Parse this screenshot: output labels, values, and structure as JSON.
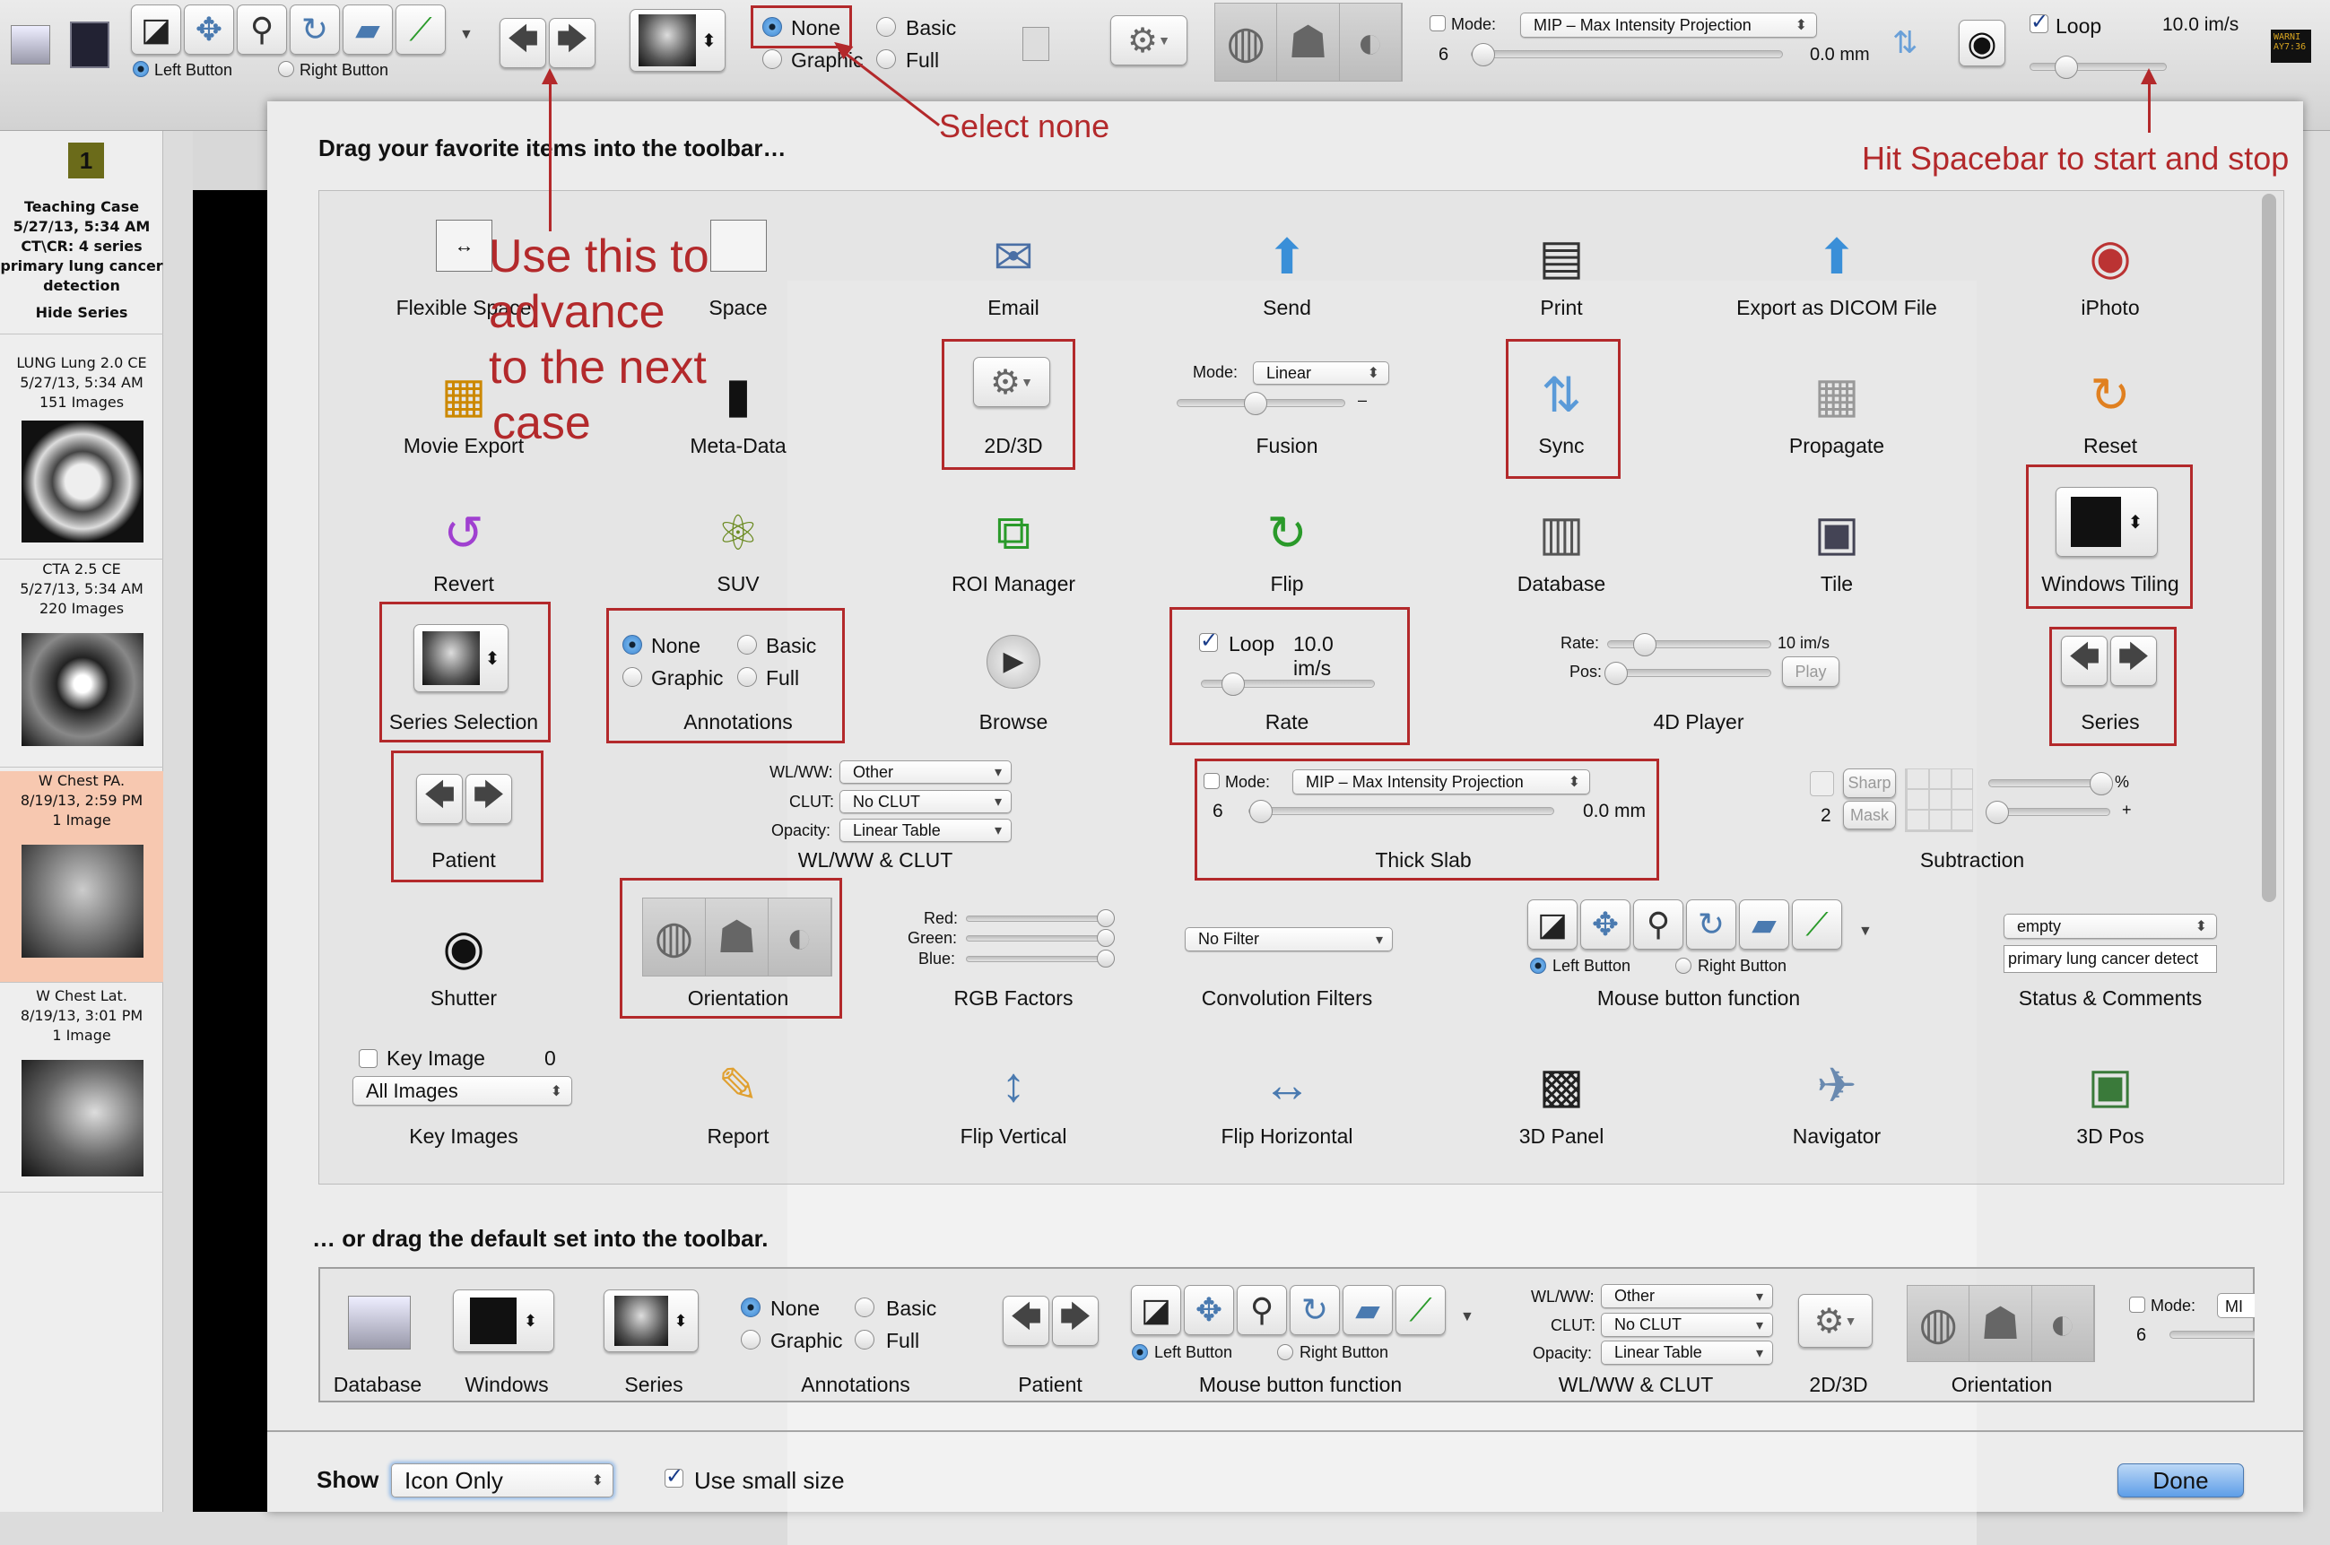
{
  "toolbar": {
    "left_button": "Left Button",
    "right_button": "Right Button",
    "ann": {
      "none": "None",
      "basic": "Basic",
      "graphic": "Graphic",
      "full": "Full",
      "selected": "None"
    },
    "mode_label": "Mode:",
    "mode_value": "MIP – Max Intensity Projection",
    "slab_count": "6",
    "slab_thickness": "0.0 mm",
    "loop_label": "Loop",
    "loop_checked": true,
    "rate": "10.0 im/s",
    "rate_fraction": 0.2,
    "warning_text": "WARNI AY7:36"
  },
  "tools": [
    {
      "icon": "window-level-icon",
      "glyph": "◪"
    },
    {
      "icon": "move-icon",
      "glyph": "✥"
    },
    {
      "icon": "zoom-icon",
      "glyph": "⚲"
    },
    {
      "icon": "rotate-icon",
      "glyph": "↻"
    },
    {
      "icon": "scroll-icon",
      "glyph": "▰"
    },
    {
      "icon": "length-icon",
      "glyph": "⟋"
    }
  ],
  "overlay": {
    "select_none": "Select none",
    "spacebar": "Hit Spacebar to start and stop",
    "advance_lines": [
      "Use this to",
      "advance",
      "to the next",
      "case"
    ],
    "color": "#b3292b"
  },
  "sidebar": {
    "badge": "1",
    "study": {
      "title": "Teaching Case",
      "date": "5/27/13, 5:34 AM",
      "modality": "CT\\CR: 4 series",
      "desc1": "primary lung cancer",
      "desc2": "detection",
      "hide": "Hide Series"
    },
    "series": [
      {
        "name": "LUNG Lung 2.0 CE",
        "date": "5/27/13, 5:34 AM",
        "count": "151 Images"
      },
      {
        "name": "CTA 2.5 CE",
        "date": "5/27/13, 5:34 AM",
        "count": "220 Images"
      },
      {
        "name": "W Chest PA.",
        "date": "8/19/13, 2:59 PM",
        "count": "1 Image",
        "selected": true
      },
      {
        "name": "W Chest Lat.",
        "date": "8/19/13, 3:01 PM",
        "count": "1 Image"
      }
    ],
    "selected_color": "#f7c8b0"
  },
  "sheet": {
    "title": "Drag your favorite items into the toolbar…",
    "default_title": "… or drag the default set into the toolbar."
  },
  "palette": {
    "items": [
      {
        "label": "Flexible Space",
        "icon": "flexible-space"
      },
      {
        "label": "Space",
        "icon": "space"
      },
      {
        "label": "Email",
        "icon": "email"
      },
      {
        "label": "Send",
        "icon": "send"
      },
      {
        "label": "Print",
        "icon": "print"
      },
      {
        "label": "Export as DICOM File",
        "icon": "export-dicom"
      },
      {
        "label": "iPhoto",
        "icon": "iphoto"
      },
      {
        "label": "Movie Export",
        "icon": "movie-export"
      },
      {
        "label": "Meta-Data",
        "icon": "meta-data"
      },
      {
        "label": "2D/3D",
        "icon": "custom"
      },
      {
        "label": "Fusion",
        "icon": "custom"
      },
      {
        "label": "Sync",
        "icon": "sync"
      },
      {
        "label": "Propagate",
        "icon": "propagate"
      },
      {
        "label": "Reset",
        "icon": "reset"
      },
      {
        "label": "Revert",
        "icon": "revert"
      },
      {
        "label": "SUV",
        "icon": "suv"
      },
      {
        "label": "ROI Manager",
        "icon": "roi-manager"
      },
      {
        "label": "Flip",
        "icon": "flip"
      },
      {
        "label": "Database",
        "icon": "database"
      },
      {
        "label": "Tile",
        "icon": "tile"
      },
      {
        "label": "Windows Tiling",
        "icon": "custom"
      },
      {
        "label": "Series Selection",
        "icon": "custom"
      },
      {
        "label": "Annotations",
        "icon": "custom"
      },
      {
        "label": "Browse",
        "icon": "browse"
      },
      {
        "label": "Rate",
        "icon": "custom"
      },
      {
        "label": "4D Player",
        "icon": "custom"
      },
      {
        "label": "Series",
        "icon": "custom"
      },
      {
        "label": "Patient",
        "icon": "custom"
      },
      {
        "label": "WL/WW & CLUT",
        "icon": "custom"
      },
      {
        "label": "Thick Slab",
        "icon": "custom"
      },
      {
        "label": "Subtraction",
        "icon": "custom"
      },
      {
        "label": "Shutter",
        "icon": "shutter"
      },
      {
        "label": "Orientation",
        "icon": "custom"
      },
      {
        "label": "RGB Factors",
        "icon": "custom"
      },
      {
        "label": "Convolution Filters",
        "icon": "custom"
      },
      {
        "label": "Mouse button function",
        "icon": "custom"
      },
      {
        "label": "Status & Comments",
        "icon": "custom"
      },
      {
        "label": "Key Images",
        "icon": "custom"
      },
      {
        "label": "Report",
        "icon": "report"
      },
      {
        "label": "Flip Vertical",
        "icon": "flip-vertical"
      },
      {
        "label": "Flip Horizontal",
        "icon": "flip-horizontal"
      },
      {
        "label": "3D Panel",
        "icon": "3d-panel"
      },
      {
        "label": "Navigator",
        "icon": "navigator"
      },
      {
        "label": "3D Pos",
        "icon": "3d-pos"
      }
    ],
    "fusion": {
      "mode_label": "Mode:",
      "mode_value": "Linear",
      "minus": "–"
    },
    "rate": {
      "loop": "Loop",
      "value": "10.0 im/s",
      "checked": true
    },
    "player": {
      "rate_label": "Rate:",
      "rate_value": "10 im/s",
      "pos_label": "Pos:",
      "play": "Play"
    },
    "wlww": {
      "wl_label": "WL/WW:",
      "wl_value": "Other",
      "clut_label": "CLUT:",
      "clut_value": "No CLUT",
      "opacity_label": "Opacity:",
      "opacity_value": "Linear Table"
    },
    "thick_slab": {
      "mode_label": "Mode:",
      "mode_value": "MIP – Max Intensity Projection",
      "count": "6",
      "thickness": "0.0 mm"
    },
    "subtraction": {
      "sharp": "Sharp",
      "mask": "Mask",
      "count": "2",
      "percent": "%",
      "plus": "+"
    },
    "rgb": {
      "red": "Red:",
      "green": "Green:",
      "blue": "Blue:"
    },
    "convolution": {
      "value": "No Filter"
    },
    "status": {
      "value": "empty",
      "comment": "primary lung cancer detect"
    },
    "key_images": {
      "label": "Key Image",
      "count": "0",
      "filter": "All Images"
    }
  },
  "default_set": {
    "labels": [
      "Database",
      "Windows",
      "Series",
      "Annotations",
      "Patient",
      "Mouse button function",
      "WL/WW & CLUT",
      "2D/3D",
      "Orientation"
    ],
    "mode_label": "Mode:",
    "mode_value": "MI",
    "count": "6"
  },
  "footer": {
    "show_label": "Show",
    "show_value": "Icon Only",
    "small_size_label": "Use small size",
    "small_size_checked": true,
    "done": "Done"
  }
}
